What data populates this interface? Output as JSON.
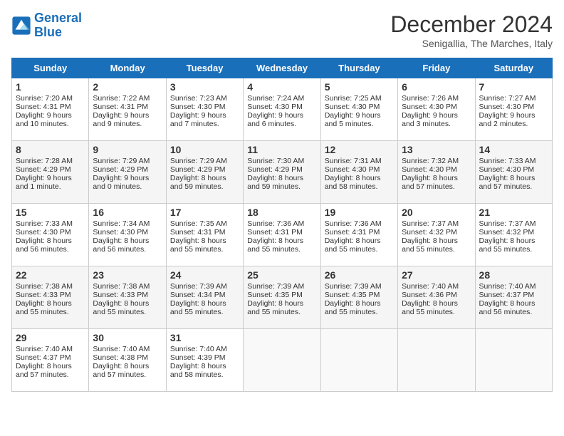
{
  "header": {
    "logo_line1": "General",
    "logo_line2": "Blue",
    "month": "December 2024",
    "location": "Senigallia, The Marches, Italy"
  },
  "days_of_week": [
    "Sunday",
    "Monday",
    "Tuesday",
    "Wednesday",
    "Thursday",
    "Friday",
    "Saturday"
  ],
  "weeks": [
    [
      {
        "day": "1",
        "sunrise": "Sunrise: 7:20 AM",
        "sunset": "Sunset: 4:31 PM",
        "daylight": "Daylight: 9 hours and 10 minutes."
      },
      {
        "day": "2",
        "sunrise": "Sunrise: 7:22 AM",
        "sunset": "Sunset: 4:31 PM",
        "daylight": "Daylight: 9 hours and 9 minutes."
      },
      {
        "day": "3",
        "sunrise": "Sunrise: 7:23 AM",
        "sunset": "Sunset: 4:30 PM",
        "daylight": "Daylight: 9 hours and 7 minutes."
      },
      {
        "day": "4",
        "sunrise": "Sunrise: 7:24 AM",
        "sunset": "Sunset: 4:30 PM",
        "daylight": "Daylight: 9 hours and 6 minutes."
      },
      {
        "day": "5",
        "sunrise": "Sunrise: 7:25 AM",
        "sunset": "Sunset: 4:30 PM",
        "daylight": "Daylight: 9 hours and 5 minutes."
      },
      {
        "day": "6",
        "sunrise": "Sunrise: 7:26 AM",
        "sunset": "Sunset: 4:30 PM",
        "daylight": "Daylight: 9 hours and 3 minutes."
      },
      {
        "day": "7",
        "sunrise": "Sunrise: 7:27 AM",
        "sunset": "Sunset: 4:30 PM",
        "daylight": "Daylight: 9 hours and 2 minutes."
      }
    ],
    [
      {
        "day": "8",
        "sunrise": "Sunrise: 7:28 AM",
        "sunset": "Sunset: 4:29 PM",
        "daylight": "Daylight: 9 hours and 1 minute."
      },
      {
        "day": "9",
        "sunrise": "Sunrise: 7:29 AM",
        "sunset": "Sunset: 4:29 PM",
        "daylight": "Daylight: 9 hours and 0 minutes."
      },
      {
        "day": "10",
        "sunrise": "Sunrise: 7:29 AM",
        "sunset": "Sunset: 4:29 PM",
        "daylight": "Daylight: 8 hours and 59 minutes."
      },
      {
        "day": "11",
        "sunrise": "Sunrise: 7:30 AM",
        "sunset": "Sunset: 4:29 PM",
        "daylight": "Daylight: 8 hours and 59 minutes."
      },
      {
        "day": "12",
        "sunrise": "Sunrise: 7:31 AM",
        "sunset": "Sunset: 4:30 PM",
        "daylight": "Daylight: 8 hours and 58 minutes."
      },
      {
        "day": "13",
        "sunrise": "Sunrise: 7:32 AM",
        "sunset": "Sunset: 4:30 PM",
        "daylight": "Daylight: 8 hours and 57 minutes."
      },
      {
        "day": "14",
        "sunrise": "Sunrise: 7:33 AM",
        "sunset": "Sunset: 4:30 PM",
        "daylight": "Daylight: 8 hours and 57 minutes."
      }
    ],
    [
      {
        "day": "15",
        "sunrise": "Sunrise: 7:33 AM",
        "sunset": "Sunset: 4:30 PM",
        "daylight": "Daylight: 8 hours and 56 minutes."
      },
      {
        "day": "16",
        "sunrise": "Sunrise: 7:34 AM",
        "sunset": "Sunset: 4:30 PM",
        "daylight": "Daylight: 8 hours and 56 minutes."
      },
      {
        "day": "17",
        "sunrise": "Sunrise: 7:35 AM",
        "sunset": "Sunset: 4:31 PM",
        "daylight": "Daylight: 8 hours and 55 minutes."
      },
      {
        "day": "18",
        "sunrise": "Sunrise: 7:36 AM",
        "sunset": "Sunset: 4:31 PM",
        "daylight": "Daylight: 8 hours and 55 minutes."
      },
      {
        "day": "19",
        "sunrise": "Sunrise: 7:36 AM",
        "sunset": "Sunset: 4:31 PM",
        "daylight": "Daylight: 8 hours and 55 minutes."
      },
      {
        "day": "20",
        "sunrise": "Sunrise: 7:37 AM",
        "sunset": "Sunset: 4:32 PM",
        "daylight": "Daylight: 8 hours and 55 minutes."
      },
      {
        "day": "21",
        "sunrise": "Sunrise: 7:37 AM",
        "sunset": "Sunset: 4:32 PM",
        "daylight": "Daylight: 8 hours and 55 minutes."
      }
    ],
    [
      {
        "day": "22",
        "sunrise": "Sunrise: 7:38 AM",
        "sunset": "Sunset: 4:33 PM",
        "daylight": "Daylight: 8 hours and 55 minutes."
      },
      {
        "day": "23",
        "sunrise": "Sunrise: 7:38 AM",
        "sunset": "Sunset: 4:33 PM",
        "daylight": "Daylight: 8 hours and 55 minutes."
      },
      {
        "day": "24",
        "sunrise": "Sunrise: 7:39 AM",
        "sunset": "Sunset: 4:34 PM",
        "daylight": "Daylight: 8 hours and 55 minutes."
      },
      {
        "day": "25",
        "sunrise": "Sunrise: 7:39 AM",
        "sunset": "Sunset: 4:35 PM",
        "daylight": "Daylight: 8 hours and 55 minutes."
      },
      {
        "day": "26",
        "sunrise": "Sunrise: 7:39 AM",
        "sunset": "Sunset: 4:35 PM",
        "daylight": "Daylight: 8 hours and 55 minutes."
      },
      {
        "day": "27",
        "sunrise": "Sunrise: 7:40 AM",
        "sunset": "Sunset: 4:36 PM",
        "daylight": "Daylight: 8 hours and 55 minutes."
      },
      {
        "day": "28",
        "sunrise": "Sunrise: 7:40 AM",
        "sunset": "Sunset: 4:37 PM",
        "daylight": "Daylight: 8 hours and 56 minutes."
      }
    ],
    [
      {
        "day": "29",
        "sunrise": "Sunrise: 7:40 AM",
        "sunset": "Sunset: 4:37 PM",
        "daylight": "Daylight: 8 hours and 57 minutes."
      },
      {
        "day": "30",
        "sunrise": "Sunrise: 7:40 AM",
        "sunset": "Sunset: 4:38 PM",
        "daylight": "Daylight: 8 hours and 57 minutes."
      },
      {
        "day": "31",
        "sunrise": "Sunrise: 7:40 AM",
        "sunset": "Sunset: 4:39 PM",
        "daylight": "Daylight: 8 hours and 58 minutes."
      },
      null,
      null,
      null,
      null
    ]
  ]
}
